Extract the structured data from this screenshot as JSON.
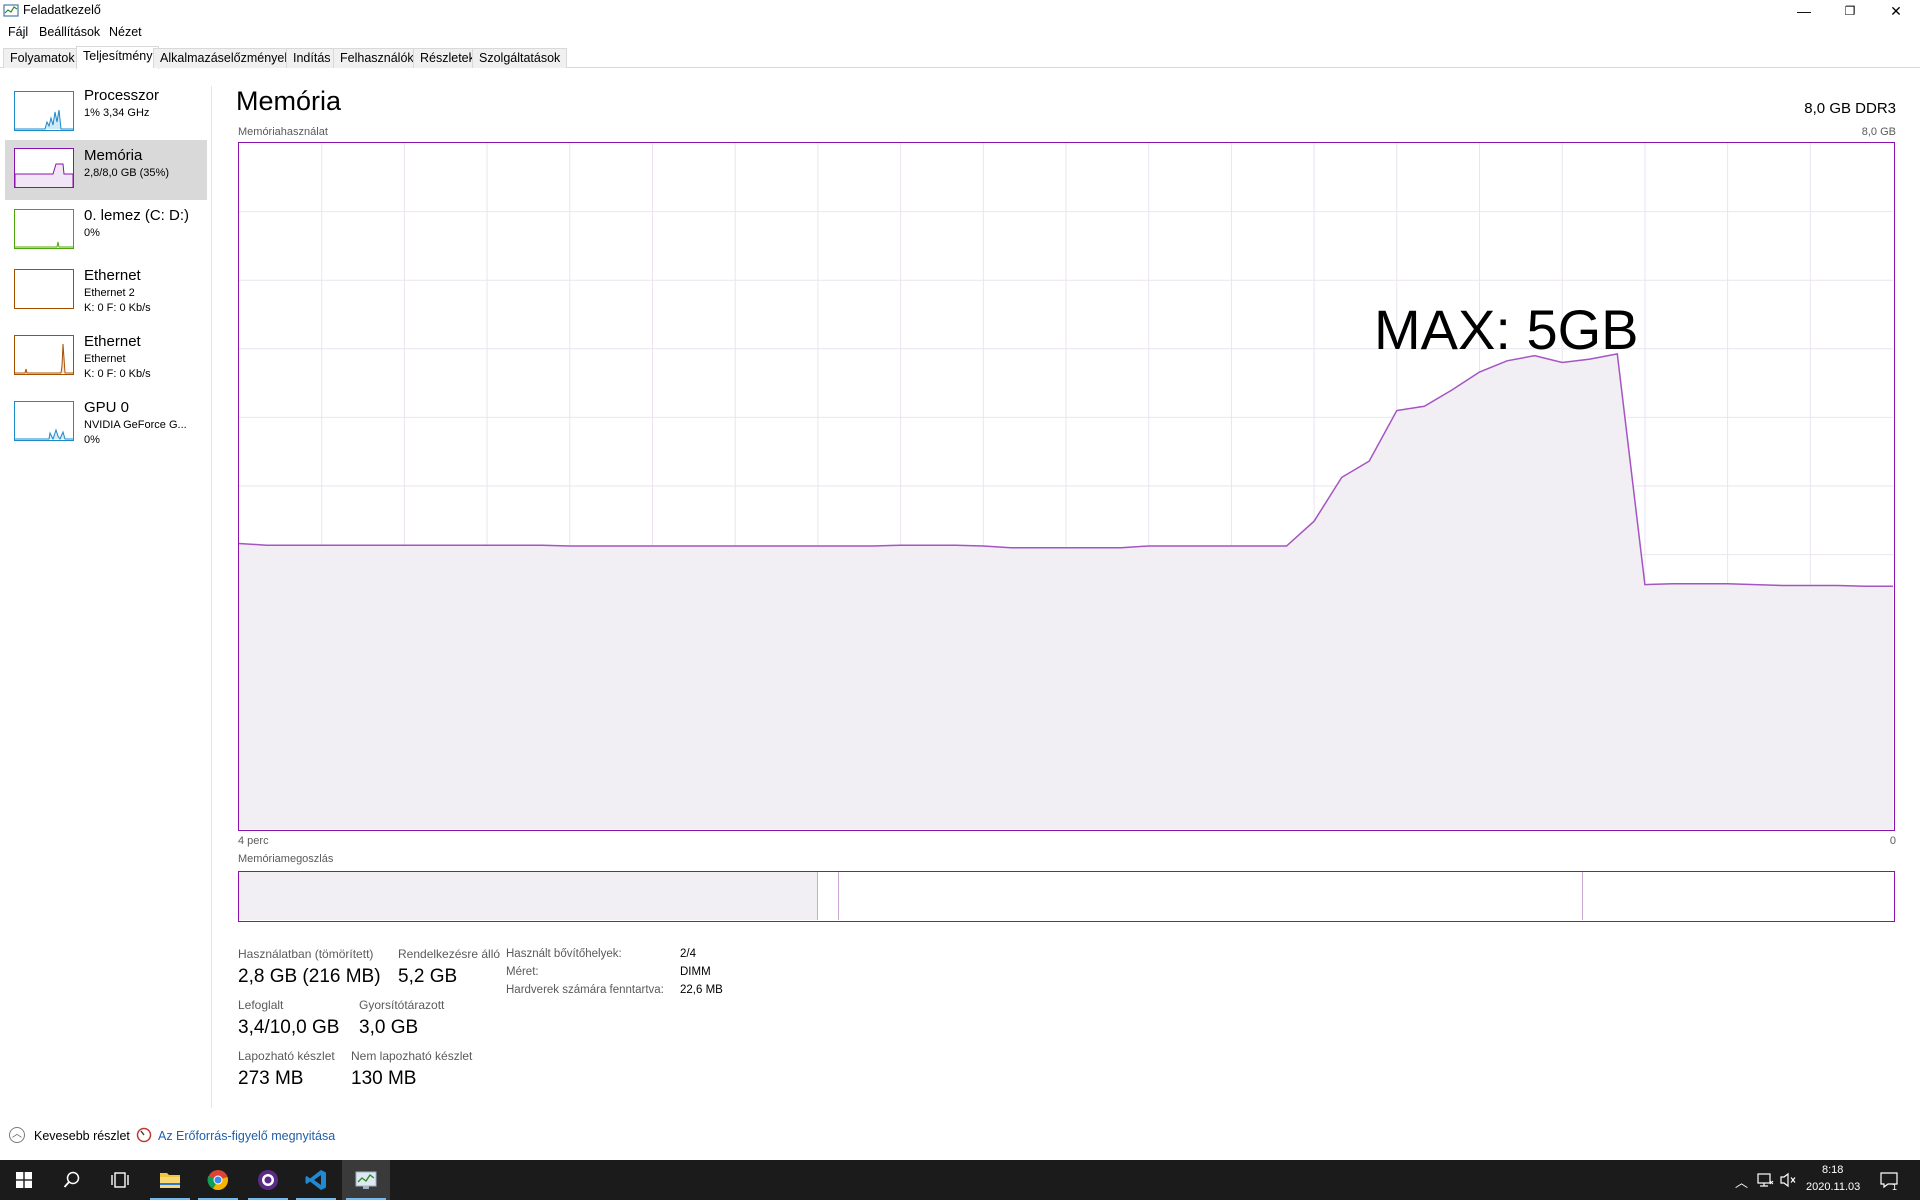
{
  "window": {
    "title": "Feladatkezelő",
    "minimize_glyph": "—",
    "restore_glyph": "❐",
    "close_glyph": "✕"
  },
  "menu": [
    "Fájl",
    "Beállítások",
    "Nézet"
  ],
  "tabs": [
    "Folyamatok",
    "Teljesítmény",
    "Alkalmazáselőzmények",
    "Indítás",
    "Felhasználók",
    "Részletek",
    "Szolgáltatások"
  ],
  "active_tab": "Teljesítmény",
  "sidebar": {
    "items": [
      {
        "name": "Processzor",
        "sub1": "1% 3,34 GHz",
        "sub2": "",
        "color": "#1a8ac9"
      },
      {
        "name": "Memória",
        "sub1": "2,8/8,0 GB (35%)",
        "sub2": "",
        "color": "#8b12ae"
      },
      {
        "name": "0. lemez (C: D:)",
        "sub1": "0%",
        "sub2": "",
        "color": "#4da60c"
      },
      {
        "name": "Ethernet",
        "sub1": "Ethernet 2",
        "sub2": "K: 0 F: 0 Kb/s",
        "color": "#a74f01"
      },
      {
        "name": "Ethernet",
        "sub1": "Ethernet",
        "sub2": "K: 0 F: 0 Kb/s",
        "color": "#a74f01"
      },
      {
        "name": "GPU 0",
        "sub1": "NVIDIA GeForce G...",
        "sub2": "0%",
        "color": "#1a8ac9"
      }
    ]
  },
  "main": {
    "title": "Memória",
    "spec": "8,0 GB DDR3",
    "chart_label": "Memóriahasználat",
    "chart_max_label": "8,0 GB",
    "x_left_label": "4 perc",
    "x_right_label": "0",
    "composition_label": "Memóriamegoszlás",
    "annotation": "MAX: 5GB"
  },
  "stats": {
    "in_use_label": "Használatban (tömörített)",
    "in_use_value": "2,8 GB (216 MB)",
    "available_label": "Rendelkezésre álló",
    "available_value": "5,2 GB",
    "committed_label": "Lefoglalt",
    "committed_value": "3,4/10,0 GB",
    "cached_label": "Gyorsítótárazott",
    "cached_value": "3,0 GB",
    "paged_label": "Lapozható készlet",
    "paged_value": "273 MB",
    "nonpaged_label": "Nem lapozható készlet",
    "nonpaged_value": "130 MB"
  },
  "info": {
    "slots_label": "Használt bővítőhelyek:",
    "slots_value": "2/4",
    "form_label": "Méret:",
    "form_value": "DIMM",
    "reserved_label": "Hardverek számára fenntartva:",
    "reserved_value": "22,6 MB"
  },
  "footer": {
    "fewer_details": "Kevesebb részlet",
    "resource_monitor": "Az Erőforrás-figyelő megnyitása"
  },
  "taskbar": {
    "time": "8:18",
    "date": "2020.11.03",
    "notification_count": "1"
  },
  "chart_data": {
    "type": "area",
    "title": "Memóriahasználat",
    "ylim": [
      0,
      8
    ],
    "y_unit": "GB",
    "x_labels": [
      "4 perc",
      "0"
    ],
    "series": [
      {
        "values": [
          3.33,
          3.31,
          3.31,
          3.31,
          3.31,
          3.31,
          3.31,
          3.31,
          3.31,
          3.31,
          3.31,
          3.31,
          3.3,
          3.3,
          3.3,
          3.3,
          3.3,
          3.3,
          3.3,
          3.3,
          3.3,
          3.3,
          3.3,
          3.3,
          3.31,
          3.31,
          3.31,
          3.3,
          3.28,
          3.28,
          3.28,
          3.28,
          3.28,
          3.3,
          3.3,
          3.3,
          3.3,
          3.3,
          3.3,
          3.59,
          4.1,
          4.29,
          4.88,
          4.93,
          5.12,
          5.33,
          5.46,
          5.52,
          5.44,
          5.48,
          5.54,
          2.85,
          2.86,
          2.86,
          2.86,
          2.85,
          2.84,
          2.84,
          2.84,
          2.83,
          2.83
        ]
      }
    ],
    "grid": true,
    "grid_cols": 20,
    "grid_rows": 10,
    "composition": {
      "in_use_gb": 2.8,
      "modified_gb": 0.1,
      "standby_gb": 3.6,
      "free_gb": 1.5
    }
  }
}
